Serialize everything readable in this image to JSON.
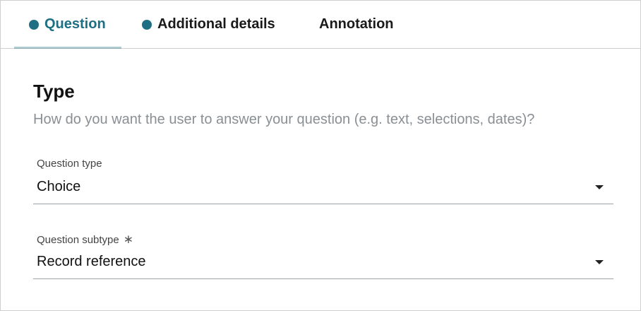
{
  "tabs": [
    {
      "label": "Question",
      "dot": true,
      "active": true
    },
    {
      "label": "Additional details",
      "dot": true,
      "active": false
    },
    {
      "label": "Annotation",
      "dot": false,
      "active": false
    }
  ],
  "section": {
    "title": "Type",
    "description": "How do you want the user to answer your question (e.g. text, selections, dates)?"
  },
  "fields": {
    "question_type": {
      "label": "Question type",
      "value": "Choice"
    },
    "question_subtype": {
      "label": "Question subtype",
      "required_mark": "∗",
      "value": "Record reference"
    }
  },
  "colors": {
    "accent": "#1f6f84",
    "dot": "#1f6f84",
    "muted_text": "#8a8f93",
    "divider": "#cfcfcf"
  },
  "icons": {
    "tab_dot": "status-dot-icon",
    "dropdown": "caret-down-icon"
  }
}
